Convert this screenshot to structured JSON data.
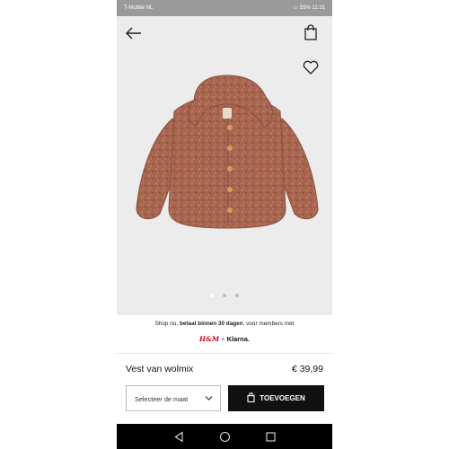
{
  "status_bar": {
    "carrier": "T-Mobile NL",
    "battery": "55%",
    "time": "11:31"
  },
  "header": {
    "back_icon": "arrow-left-icon",
    "bag_icon": "shopping-bag-icon",
    "favorite_icon": "heart-icon"
  },
  "product_image": {
    "subject": "teddy fleece hooded baby jacket",
    "colors": {
      "fabric": "#a7654f",
      "buttons": "#c9a35c"
    },
    "carousel": {
      "count": 3,
      "active_index": 0
    }
  },
  "promo": {
    "text_before": "Shop nu, ",
    "text_bold": "betaal binnen 30 dagen",
    "text_after": ". voor members met",
    "brand_hm": "H&M",
    "separator": "×",
    "brand_klarna": "Klarna."
  },
  "product": {
    "name": "Vest van wolmix",
    "price": "€ 39,99"
  },
  "size_select": {
    "placeholder": "Selecteer de maat"
  },
  "add_button": {
    "label": "TOEVOEGEN"
  },
  "colors": {
    "accent": "#111111",
    "status_bar": "#9a9a9a",
    "image_bg": "#ececec",
    "hm_red": "#d0021b"
  }
}
